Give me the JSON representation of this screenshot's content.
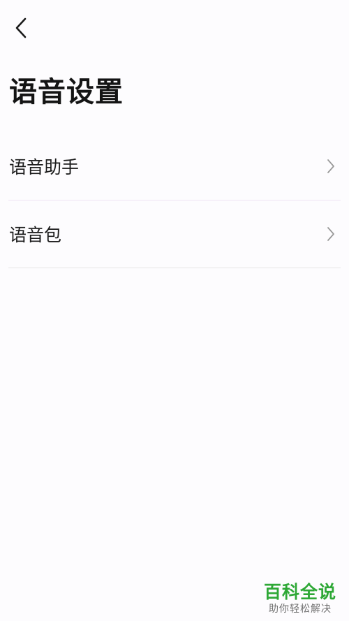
{
  "header": {
    "back_icon": "chevron-left-icon",
    "title": "语音设置"
  },
  "settings": {
    "items": [
      {
        "label": "语音助手",
        "icon": "chevron-right-icon"
      },
      {
        "label": "语音包",
        "icon": "chevron-right-icon"
      }
    ]
  },
  "watermark": {
    "brand": "百科全说",
    "slogan": "助你轻松解决",
    "brand_color": "#2ea836"
  },
  "colors": {
    "background": "#fdfcfe",
    "text": "#1a1a1a",
    "divider": "#e6e6e6",
    "chevron": "#9a9a9a"
  }
}
